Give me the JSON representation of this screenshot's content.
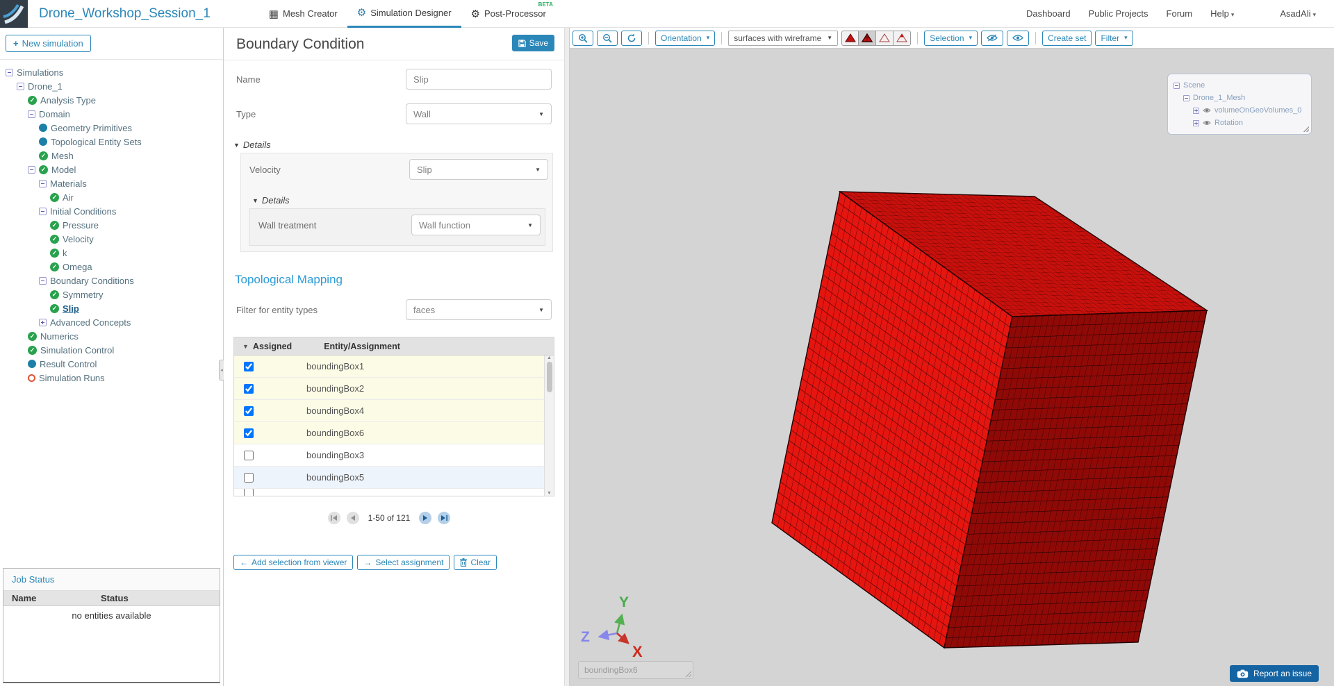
{
  "header": {
    "project_title": "Drone_Workshop_Session_1",
    "tabs": [
      {
        "label": "Mesh Creator",
        "icon": "grid-icon",
        "active": false,
        "beta": ""
      },
      {
        "label": "Simulation Designer",
        "icon": "gears-icon",
        "active": true,
        "beta": ""
      },
      {
        "label": "Post-Processor",
        "icon": "gear-icon",
        "active": false,
        "beta": "BETA"
      }
    ],
    "nav": [
      {
        "label": "Dashboard"
      },
      {
        "label": "Public Projects"
      },
      {
        "label": "Forum"
      },
      {
        "label": "Help",
        "dropdown": true
      }
    ],
    "user": {
      "name": "AsadAli",
      "dropdown": true
    }
  },
  "sidebar": {
    "new_simulation": "New simulation",
    "tree": [
      {
        "label": "Simulations",
        "icon": "collapse"
      },
      {
        "label": "Drone_1",
        "icon": "collapse"
      },
      {
        "label": "Analysis Type",
        "icon": "check"
      },
      {
        "label": "Domain",
        "icon": "collapse"
      },
      {
        "label": "Geometry Primitives",
        "icon": "blue-dot"
      },
      {
        "label": "Topological Entity Sets",
        "icon": "blue-dot"
      },
      {
        "label": "Mesh",
        "icon": "check"
      },
      {
        "label": "Model",
        "icon": "collapse+check"
      },
      {
        "label": "Materials",
        "icon": "collapse"
      },
      {
        "label": "Air",
        "icon": "check"
      },
      {
        "label": "Initial Conditions",
        "icon": "collapse"
      },
      {
        "label": "Pressure",
        "icon": "check"
      },
      {
        "label": "Velocity",
        "icon": "check"
      },
      {
        "label": "k",
        "icon": "check"
      },
      {
        "label": "Omega",
        "icon": "check"
      },
      {
        "label": "Boundary Conditions",
        "icon": "collapse"
      },
      {
        "label": "Symmetry",
        "icon": "check"
      },
      {
        "label": "Slip",
        "icon": "check",
        "selected": true
      },
      {
        "label": "Advanced Concepts",
        "icon": "expand"
      },
      {
        "label": "Numerics",
        "icon": "check"
      },
      {
        "label": "Simulation Control",
        "icon": "check"
      },
      {
        "label": "Result Control",
        "icon": "blue-dot"
      },
      {
        "label": "Simulation Runs",
        "icon": "red-ring"
      }
    ],
    "job_status": {
      "title": "Job Status",
      "col_name": "Name",
      "col_status": "Status",
      "empty": "no entities available"
    }
  },
  "form": {
    "title": "Boundary Condition",
    "save": "Save",
    "fields": {
      "name_label": "Name",
      "name_value": "Slip",
      "type_label": "Type",
      "type_value": "Wall",
      "details_label": "Details",
      "velocity_label": "Velocity",
      "velocity_value": "Slip",
      "details2_label": "Details",
      "wall_treatment_label": "Wall treatment",
      "wall_treatment_value": "Wall function"
    },
    "topo": {
      "title": "Topological Mapping",
      "filter_label": "Filter for entity types",
      "filter_value": "faces",
      "table": {
        "col_assigned": "Assigned",
        "col_entity": "Entity/Assignment",
        "rows": [
          {
            "entity": "boundingBox1",
            "assigned": true
          },
          {
            "entity": "boundingBox2",
            "assigned": true
          },
          {
            "entity": "boundingBox4",
            "assigned": true
          },
          {
            "entity": "boundingBox6",
            "assigned": true
          },
          {
            "entity": "boundingBox3",
            "assigned": false
          },
          {
            "entity": "boundingBox5",
            "assigned": false
          }
        ]
      },
      "pagination": "1-50 of 121",
      "actions": [
        {
          "label": "Add selection from viewer",
          "icon": "arrow-left-icon"
        },
        {
          "label": "Select assignment",
          "icon": "arrow-right-icon"
        },
        {
          "label": "Clear",
          "icon": "trash-icon"
        }
      ]
    }
  },
  "viewer": {
    "toolbar": {
      "orientation": "Orientation",
      "display_mode": "surfaces with wireframe",
      "selection": "Selection",
      "create_set": "Create set",
      "filter": "Filter"
    },
    "scene_tree": [
      {
        "label": "Scene"
      },
      {
        "label": "Drone_1_Mesh"
      },
      {
        "label": "volumeOnGeoVolumes_0"
      },
      {
        "label": "Rotation"
      }
    ],
    "axis": {
      "x": "X",
      "y": "Y",
      "z": "Z"
    },
    "entity_tooltip": "boundingBox6",
    "report_issue": "Report an issue"
  },
  "colors": {
    "accent": "#2b87b8",
    "beta_green": "#27ae60",
    "check_green": "#28a24c",
    "node_blue": "#1d7fa8",
    "run_ring_red": "#e05335",
    "cube_front": "#e51510",
    "cube_top": "#c8100c",
    "cube_right": "#8f0a07",
    "axis_x_red": "#c8352a",
    "axis_y_green": "#54b152",
    "axis_z_blue": "#8787ec"
  }
}
